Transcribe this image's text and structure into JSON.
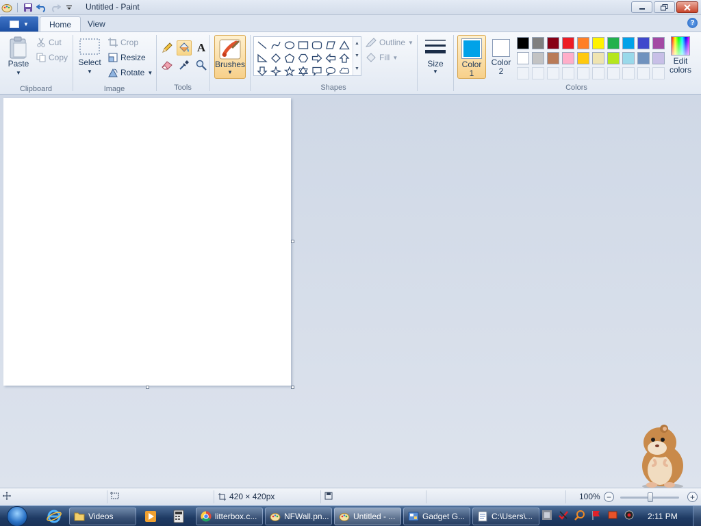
{
  "window": {
    "title": "Untitled - Paint",
    "qat_icons": [
      "save-icon",
      "undo-icon",
      "redo-icon",
      "customize-qat-icon"
    ]
  },
  "tabs": [
    {
      "label": "Home",
      "active": true
    },
    {
      "label": "View",
      "active": false
    }
  ],
  "clipboard": {
    "paste_label": "Paste",
    "cut_label": "Cut",
    "copy_label": "Copy",
    "group_label": "Clipboard"
  },
  "image": {
    "select_label": "Select",
    "crop_label": "Crop",
    "resize_label": "Resize",
    "rotate_label": "Rotate",
    "group_label": "Image"
  },
  "tools": {
    "group_label": "Tools",
    "items": [
      "pencil-icon",
      "fill-bucket-icon",
      "text-icon",
      "eraser-icon",
      "color-picker-icon",
      "magnifier-icon"
    ],
    "selected": "fill-bucket-icon"
  },
  "brushes": {
    "label": "Brushes"
  },
  "shapes": {
    "outline_label": "Outline",
    "fill_label": "Fill",
    "group_label": "Shapes"
  },
  "size": {
    "label": "Size"
  },
  "colors": {
    "color1_line1": "Color",
    "color1_line2": "1",
    "color2_line1": "Color",
    "color2_line2": "2",
    "color1_value": "#00a2e8",
    "color2_value": "#ffffff",
    "edit_line1": "Edit",
    "edit_line2": "colors",
    "group_label": "Colors",
    "palette_row1": [
      "#000000",
      "#7f7f7f",
      "#880015",
      "#ed1c24",
      "#ff7f27",
      "#fff200",
      "#22b14c",
      "#00a2e8",
      "#3f48cc",
      "#a349a4"
    ],
    "palette_row2": [
      "#ffffff",
      "#c3c3c3",
      "#b97a57",
      "#ffaec9",
      "#ffc90e",
      "#efe4b0",
      "#b5e61d",
      "#99d9ea",
      "#7092be",
      "#c8bfe7"
    ]
  },
  "status": {
    "size_text": "420 × 420px",
    "zoom_text": "100%"
  },
  "taskbar": {
    "buttons": [
      {
        "label": "Videos",
        "icon": "folder-icon"
      },
      {
        "label": "litterbox.c...",
        "icon": "chrome-icon"
      },
      {
        "label": "NFWall.pn...",
        "icon": "paint-icon"
      },
      {
        "label": "Untitled - ...",
        "icon": "paint-icon"
      },
      {
        "label": "Gadget G...",
        "icon": "gadget-icon"
      },
      {
        "label": "C:\\Users\\...",
        "icon": "notepad-icon"
      }
    ],
    "clock": "2:11 PM"
  }
}
